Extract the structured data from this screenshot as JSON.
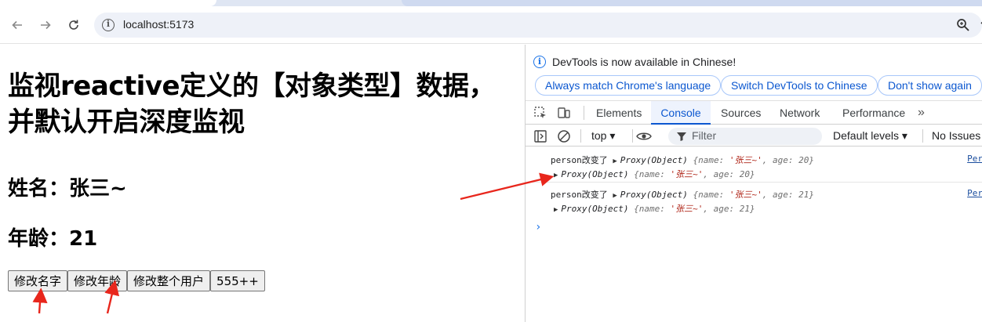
{
  "browser": {
    "url": "localhost:5173",
    "icons": [
      "back-arrow-icon",
      "forward-arrow-icon",
      "reload-icon",
      "info-icon",
      "zoom-icon",
      "share-icon"
    ]
  },
  "page": {
    "heading": "监视reactive定义的【对象类型】数据，并默认开启深度监视",
    "name_line": "姓名：张三~",
    "age_line": "年龄：21",
    "buttons": {
      "change_name": "修改名字",
      "change_age": "修改年龄",
      "change_user": "修改整个用户",
      "counter": "555++"
    }
  },
  "devtools": {
    "infobar": {
      "message": "DevTools is now available in Chinese!",
      "match_language": "Always match Chrome's language",
      "switch_chinese": "Switch DevTools to Chinese",
      "dont_show": "Don't show again"
    },
    "tabs": {
      "elements": "Elements",
      "console": "Console",
      "sources": "Sources",
      "network": "Network",
      "performance": "Performance",
      "more": "»"
    },
    "console_toolbar": {
      "context": "top ▾",
      "filter_placeholder": "Filter",
      "levels": "Default levels ▾",
      "issues": "No Issues"
    },
    "logs": [
      {
        "prefix": "person改变了",
        "proxy_label": "Proxy(Object)",
        "source": "Per",
        "line1": {
          "open": "{",
          "name_key": "name:",
          "name_val": "'张三~'",
          "age_key": ", age:",
          "age_val": "20",
          "close": "}"
        },
        "line2": {
          "open": "{",
          "name_key": "name:",
          "name_val": "'张三~'",
          "age_key": ", age:",
          "age_val": "20",
          "close": "}"
        }
      },
      {
        "prefix": "person改变了",
        "proxy_label": "Proxy(Object)",
        "source": "Per",
        "line1": {
          "open": "{",
          "name_key": "name:",
          "name_val": "'张三~'",
          "age_key": ", age:",
          "age_val": "21",
          "close": "}"
        },
        "line2": {
          "open": "{",
          "name_key": "name:",
          "name_val": "'张三~'",
          "age_key": ", age:",
          "age_val": "21",
          "close": "}"
        }
      }
    ],
    "prompt": "›"
  },
  "colors": {
    "accent_blue": "#0b57d0",
    "annotation_red": "#e8261c",
    "string_red": "#b0271a"
  }
}
